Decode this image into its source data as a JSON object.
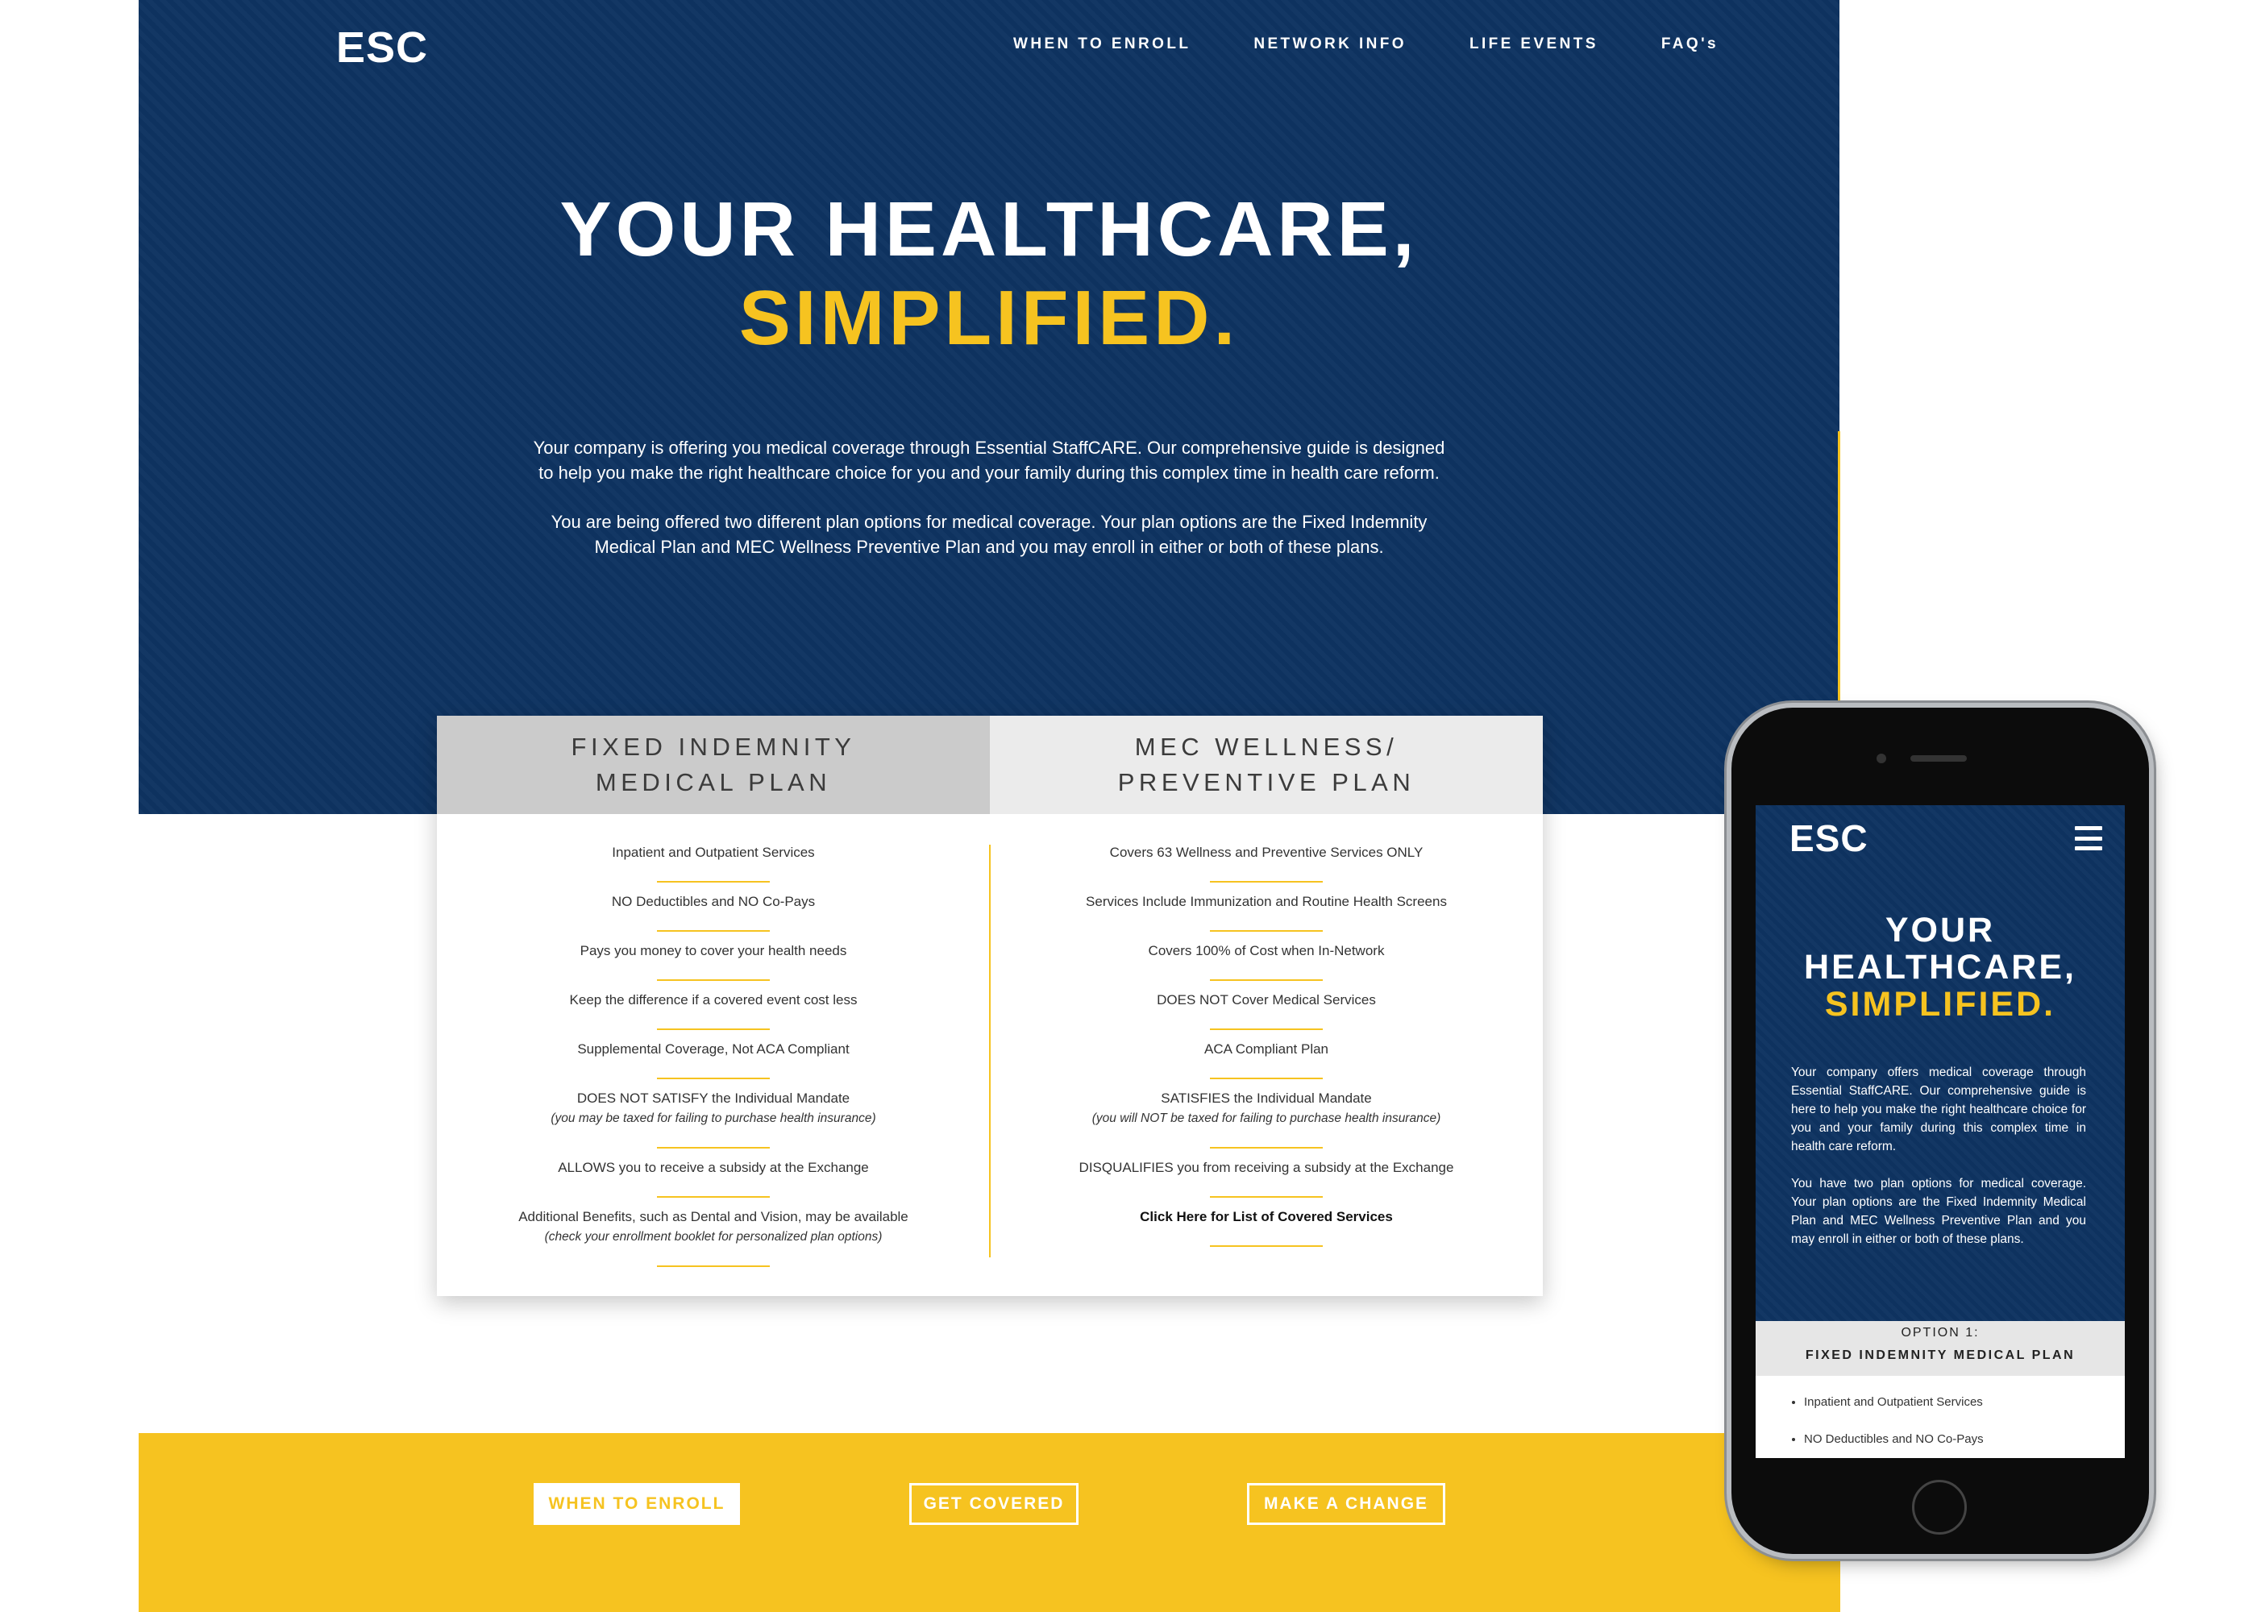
{
  "brand": {
    "logo": "ESC",
    "colors": {
      "navy": "#0e3361",
      "yellow": "#f6c320",
      "white": "#ffffff"
    }
  },
  "nav": {
    "items": [
      "WHEN TO ENROLL",
      "NETWORK INFO",
      "LIFE EVENTS",
      "FAQ's"
    ]
  },
  "hero": {
    "headline_line1": "YOUR HEALTHCARE,",
    "headline_line2": "SIMPLIFIED.",
    "paragraph1": "Your company is offering you medical coverage through Essential StaffCARE. Our comprehensive guide is designed to help you make the right healthcare choice for you and your family during this complex time in health care reform.",
    "paragraph2": "You are being offered two different plan options for medical coverage. Your plan options are the Fixed Indemnity Medical Plan and MEC Wellness Preventive Plan and you may enroll in either or both of these plans."
  },
  "plans": {
    "left": {
      "title_line1": "FIXED INDEMNITY",
      "title_line2": "MEDICAL PLAN",
      "items": [
        {
          "text": "Inpatient and Outpatient Services"
        },
        {
          "text": "NO Deductibles and NO Co-Pays"
        },
        {
          "text": "Pays you money to cover your health needs"
        },
        {
          "text": "Keep the difference if a covered event cost less"
        },
        {
          "text": "Supplemental Coverage, Not ACA Compliant"
        },
        {
          "text": "DOES NOT SATISFY the Individual Mandate",
          "note": "(you may be taxed for failing to purchase health insurance)"
        },
        {
          "text": "ALLOWS you to receive a subsidy at the Exchange"
        },
        {
          "text": "Additional Benefits, such as Dental and Vision, may be available",
          "note": "(check your enrollment booklet for personalized plan options)"
        }
      ]
    },
    "right": {
      "title_line1": "MEC WELLNESS/",
      "title_line2": "PREVENTIVE PLAN",
      "items": [
        {
          "text": "Covers 63 Wellness and Preventive Services ONLY"
        },
        {
          "text": "Services Include Immunization and Routine Health Screens"
        },
        {
          "text": "Covers 100% of Cost when In-Network"
        },
        {
          "text": "DOES NOT Cover Medical Services"
        },
        {
          "text": "ACA Compliant Plan"
        },
        {
          "text": "SATISFIES the Individual Mandate",
          "note": "(you will NOT be taxed for failing to purchase health insurance)"
        },
        {
          "text": "DISQUALIFIES you from receiving a subsidy at the Exchange"
        }
      ],
      "link": "Click Here for List of Covered Services"
    }
  },
  "cta": {
    "when_to_enroll": "WHEN TO ENROLL",
    "get_covered": "GET COVERED",
    "make_a_change": "MAKE A CHANGE"
  },
  "mobile": {
    "logo": "ESC",
    "menu_icon": "hamburger-menu-icon",
    "headline_line1": "YOUR",
    "headline_line2": "HEALTHCARE,",
    "headline_line3": "SIMPLIFIED.",
    "paragraph1": "Your company offers medical coverage through Essential StaffCARE. Our comprehensive guide is here to help you make the right healthcare choice for you and your family during this complex time in health care reform.",
    "paragraph2": "You have two plan options for medical coverage. Your plan options are the Fixed Indemnity Medical Plan and MEC Wellness Preventive Plan and you may enroll in either or both of these plans.",
    "option_label": "OPTION 1:",
    "option_title": "FIXED INDEMNITY MEDICAL PLAN",
    "list": [
      "Inpatient and Outpatient Services",
      "NO Deductibles and NO Co-Pays"
    ]
  }
}
